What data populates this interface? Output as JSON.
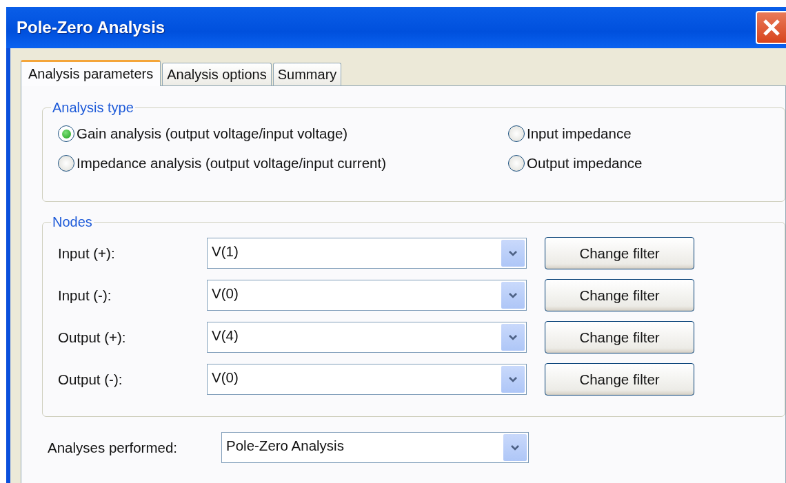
{
  "window": {
    "title": "Pole-Zero Analysis"
  },
  "tabs": [
    {
      "label": "Analysis parameters",
      "selected": true
    },
    {
      "label": "Analysis options",
      "selected": false
    },
    {
      "label": "Summary",
      "selected": false
    }
  ],
  "analysis_type": {
    "title": "Analysis type",
    "options": [
      {
        "label": "Gain analysis (output voltage/input voltage)",
        "selected": true
      },
      {
        "label": "Input impedance",
        "selected": false
      },
      {
        "label": "Impedance analysis (output voltage/input current)",
        "selected": false
      },
      {
        "label": "Output impedance",
        "selected": false
      }
    ]
  },
  "nodes": {
    "title": "Nodes",
    "rows": [
      {
        "label": "Input (+):",
        "value": "V(1)",
        "button": "Change filter"
      },
      {
        "label": "Input (-):",
        "value": "V(0)",
        "button": "Change filter"
      },
      {
        "label": "Output (+):",
        "value": "V(4)",
        "button": "Change filter"
      },
      {
        "label": "Output (-):",
        "value": "V(0)",
        "button": "Change filter"
      }
    ]
  },
  "analyses_performed": {
    "label": "Analyses performed:",
    "value": "Pole-Zero Analysis"
  }
}
